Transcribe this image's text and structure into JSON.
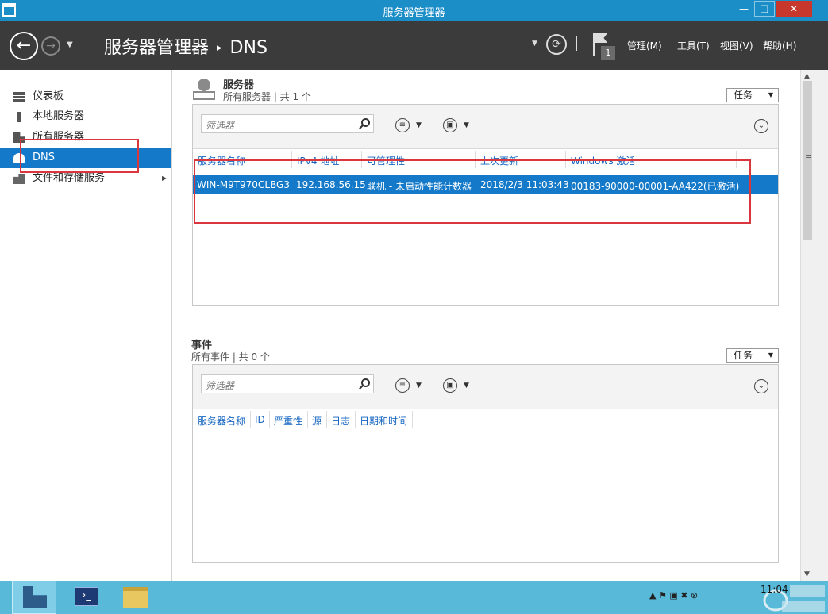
{
  "window": {
    "title": "服务器管理器",
    "controls": {
      "minimize": "—",
      "maximize": "❐",
      "close": "✕"
    }
  },
  "header": {
    "breadcrumb_root": "服务器管理器",
    "breadcrumb_sep": "▸",
    "breadcrumb_current": "DNS",
    "back_glyph": "←",
    "forward_glyph": "→",
    "refresh_glyph": "⟳",
    "notification_count": "1",
    "menus": [
      "管理(M)",
      "工具(T)",
      "视图(V)",
      "帮助(H)"
    ]
  },
  "sidebar": {
    "items": [
      {
        "label": "仪表板",
        "icon": "dashboard-icon",
        "selected": false
      },
      {
        "label": "本地服务器",
        "icon": "local-server-icon",
        "selected": false
      },
      {
        "label": "所有服务器",
        "icon": "all-servers-icon",
        "selected": false
      },
      {
        "label": "DNS",
        "icon": "dns-icon",
        "selected": true
      },
      {
        "label": "文件和存储服务",
        "icon": "file-storage-icon",
        "selected": false,
        "expandable": true
      }
    ]
  },
  "servers": {
    "title": "服务器",
    "subtitle": "所有服务器 | 共 1 个",
    "tasks_label": "任务",
    "filter_placeholder": "筛选器",
    "columns": [
      "服务器名称",
      "IPv4 地址",
      "可管理性",
      "上次更新",
      "Windows 激活"
    ],
    "rows": [
      {
        "name": "WIN-M9T970CLBG3",
        "ipv4": "192.168.56.15",
        "manageability": "联机 - 未启动性能计数器",
        "last_update": "2018/2/3 11:03:43",
        "activation": "00183-90000-00001-AA422(已激活)"
      }
    ]
  },
  "events": {
    "title": "事件",
    "subtitle": "所有事件 | 共 0 个",
    "tasks_label": "任务",
    "filter_placeholder": "筛选器",
    "columns": [
      "服务器名称",
      "ID",
      "严重性",
      "源",
      "日志",
      "日期和时间"
    ]
  },
  "taskbar": {
    "powershell_glyph": "›_",
    "clock_time": "11:04",
    "tray_glyphs": "▲  ⚑  ▣  ✖  ⊗"
  },
  "colors": {
    "titlebar": "#1c8ec7",
    "header": "#3b3b3b",
    "selection": "#1479c8",
    "highlight_box": "#d9363e",
    "taskbar": "#58b9d8"
  }
}
